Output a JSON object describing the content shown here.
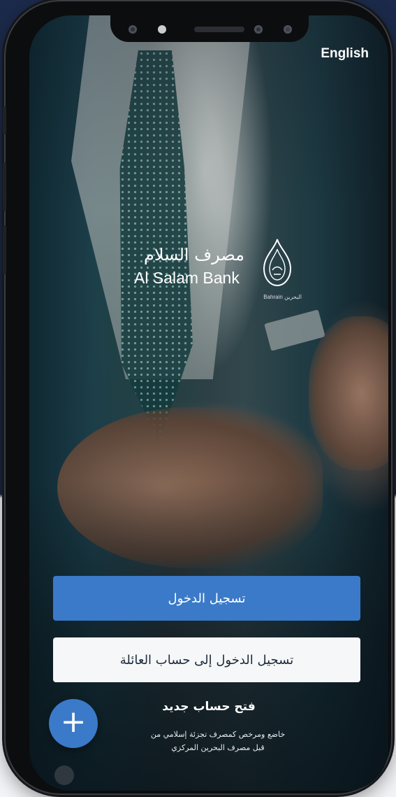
{
  "top_bar": {
    "language_toggle": "English"
  },
  "brand": {
    "name_ar": "مصرف السلام",
    "name_en": "Al Salam Bank",
    "emblem_caption": "Bahrain البحرين"
  },
  "actions": {
    "login_label": "تسجيل الدخول",
    "family_login_label": "تسجيل الدخول إلى حساب العائلة",
    "open_account_label": "فتح حساب جديد",
    "add_icon": "+"
  },
  "footer": {
    "disclaimer_line1": "خاضع ومرخص كمصرف تجزئة إسلامي من",
    "disclaimer_line2": "قبل مصرف البحرين المركزي"
  },
  "colors": {
    "primary_button": "#3b7ac9",
    "secondary_button": "#f6f7f8",
    "page_background_top": "#1b2a4a",
    "page_background_bottom": "#f3f5f8"
  },
  "icons": {
    "fab": "plus-icon",
    "emblem": "bank-emblem-icon"
  }
}
